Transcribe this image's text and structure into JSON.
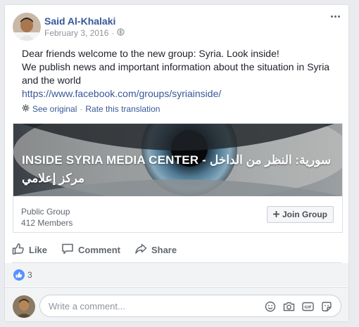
{
  "post": {
    "author": "Said Al-Khalaki",
    "date": "February 3, 2016",
    "date_separator": "·",
    "text_line1": "Dear friends welcome to the new group: Syria. Look inside!",
    "text_line2": "We publish news and important information about the situation in Syria and the world",
    "link": "https://www.facebook.com/groups/syriainside/"
  },
  "translation": {
    "see_original": "See original",
    "separator": "·",
    "rate": "Rate this translation"
  },
  "attachment": {
    "cover_title_line1": "INSIDE SYRIA MEDIA CENTER - سورية: النظر من الداخل",
    "cover_title_line2": "مركز إعلامي",
    "group_type": "Public Group",
    "members": "412 Members",
    "join_label": "Join Group"
  },
  "actions": {
    "like": "Like",
    "comment": "Comment",
    "share": "Share"
  },
  "reactions": {
    "count": "3"
  },
  "composer": {
    "placeholder": "Write a comment..."
  },
  "colors": {
    "link": "#365899",
    "like_badge": "#5890ff"
  },
  "icons": [
    "globe-icon",
    "more-options-icon",
    "gear-icon",
    "plus-icon",
    "thumbs-up-icon",
    "comment-icon",
    "share-icon",
    "smiley-icon",
    "camera-icon",
    "gif-icon",
    "sticker-icon"
  ]
}
